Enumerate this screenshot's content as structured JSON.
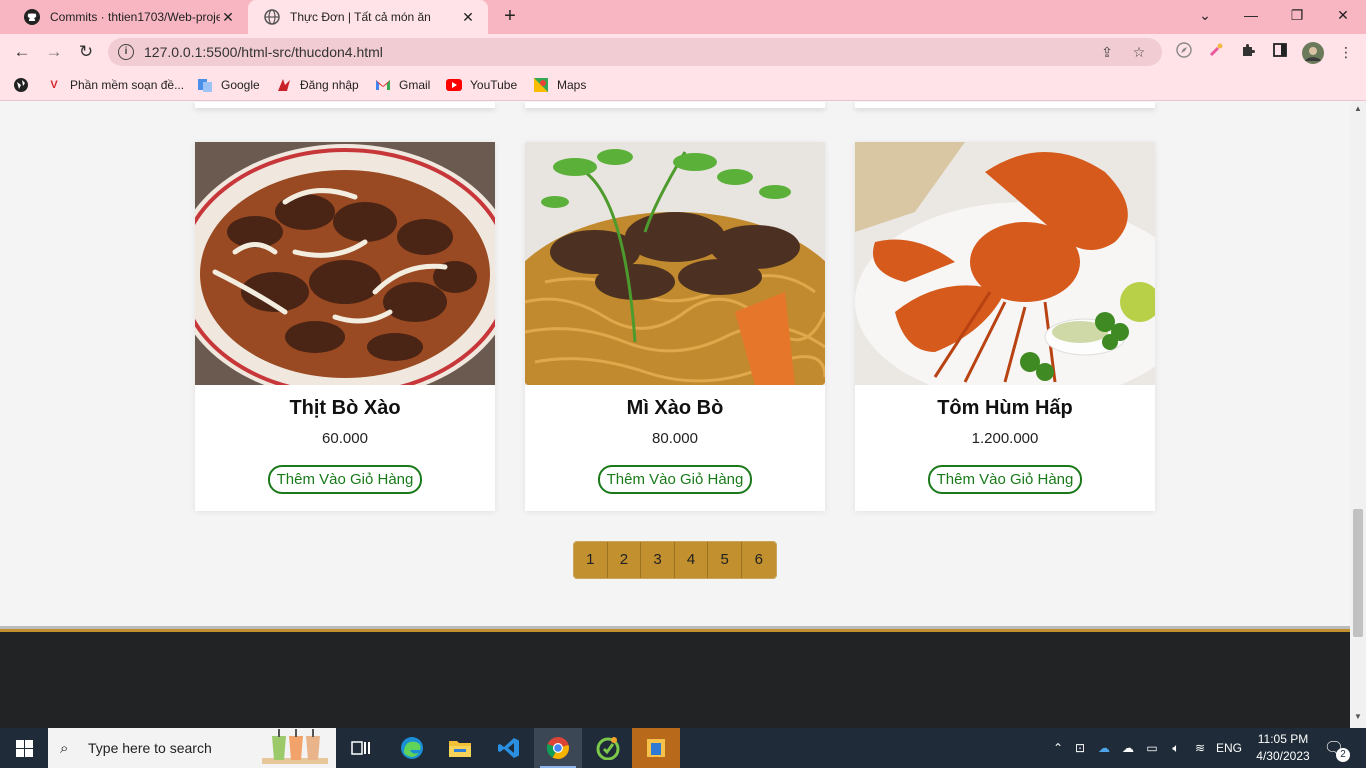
{
  "browser": {
    "tabs": [
      {
        "title": "Commits · thtien1703/Web-proje",
        "favicon": "github-icon",
        "active": false
      },
      {
        "title": "Thực Đơn | Tất cả món ăn",
        "favicon": "globe-icon",
        "active": true
      }
    ],
    "url": "127.0.0.1:5500/html-src/thucdon4.html",
    "bookmarks": [
      {
        "label": "Phần mềm soạn đề..."
      },
      {
        "label": "Google"
      },
      {
        "label": "Đăng nhập"
      },
      {
        "label": "Gmail"
      },
      {
        "label": "YouTube"
      },
      {
        "label": "Maps"
      }
    ]
  },
  "menu": {
    "items": [
      {
        "name": "Thịt Bò Xào",
        "price": "60.000",
        "button": "Thêm Vào Giỏ Hàng"
      },
      {
        "name": "Mì Xào Bò",
        "price": "80.000",
        "button": "Thêm Vào Giỏ Hàng"
      },
      {
        "name": "Tôm Hùm Hấp",
        "price": "1.200.000",
        "button": "Thêm Vào Giỏ Hàng"
      }
    ],
    "pagination": [
      "1",
      "2",
      "3",
      "4",
      "5",
      "6"
    ]
  },
  "taskbar": {
    "search_placeholder": "Type here to search",
    "language": "ENG",
    "time": "11:05 PM",
    "date": "4/30/2023",
    "notification_count": "2"
  },
  "colors": {
    "tab_strip": "#f7b6c2",
    "toolbar": "#ffe3e8",
    "pager_gold": "#c2902f",
    "cart_button_green": "#1a7a1a",
    "footer_dark": "#212325"
  }
}
